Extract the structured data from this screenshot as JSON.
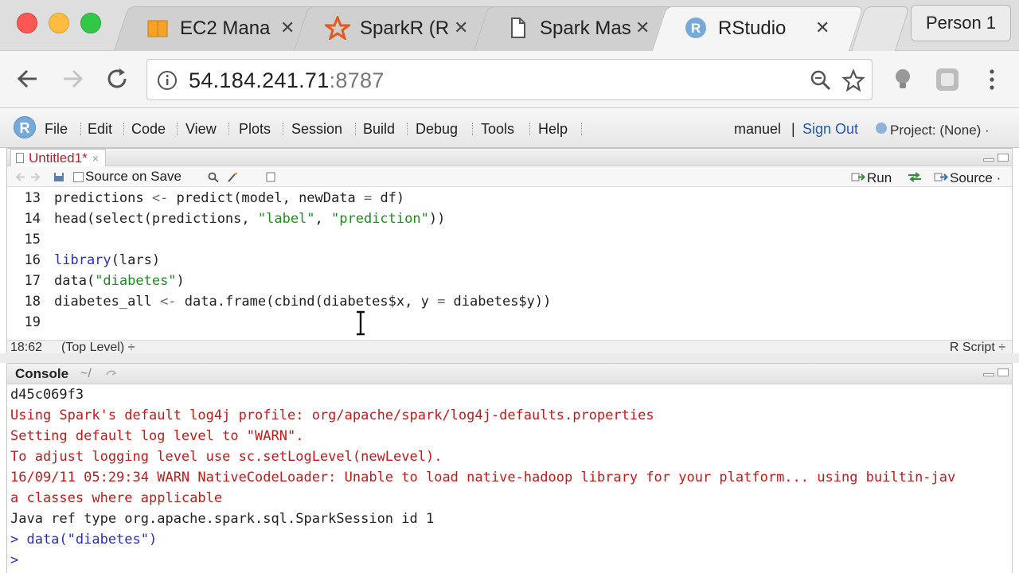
{
  "browser": {
    "tabs": [
      {
        "title": "EC2 Mana",
        "icon": "aws-cube-icon",
        "active": false
      },
      {
        "title": "SparkR (R",
        "icon": "spark-star-icon",
        "active": false
      },
      {
        "title": "Spark Mas",
        "icon": "document-icon",
        "active": false
      },
      {
        "title": "RStudio",
        "icon": "rstudio-logo-icon",
        "active": true
      }
    ],
    "person": "Person 1",
    "url_host": "54.184.241.71",
    "url_port": ":8787"
  },
  "rstudio": {
    "logo": "R",
    "menu": [
      "File",
      "Edit",
      "Code",
      "View",
      "Plots",
      "Session",
      "Build",
      "Debug",
      "Tools",
      "Help"
    ],
    "user": "manuel",
    "user_sep": "|",
    "signout": "Sign Out",
    "project": "Project: (None) ·",
    "source": {
      "tab_title": "Untitled1*",
      "tab_close": "×",
      "source_on_save": "Source on Save",
      "run_label": "Run",
      "source_label": "Source ·",
      "lines": [
        {
          "n": "13",
          "parts": [
            {
              "t": "predictions ",
              "c": ""
            },
            {
              "t": "<-",
              "c": "op"
            },
            {
              "t": " predict(model, newData ",
              "c": ""
            },
            {
              "t": "=",
              "c": "op"
            },
            {
              "t": " df)",
              "c": ""
            }
          ]
        },
        {
          "n": "14",
          "parts": [
            {
              "t": "head(select(predictions, ",
              "c": ""
            },
            {
              "t": "\"label\"",
              "c": "str"
            },
            {
              "t": ", ",
              "c": ""
            },
            {
              "t": "\"prediction\"",
              "c": "str"
            },
            {
              "t": "))",
              "c": ""
            }
          ]
        },
        {
          "n": "15",
          "parts": []
        },
        {
          "n": "16",
          "parts": [
            {
              "t": "library",
              "c": "kw"
            },
            {
              "t": "(lars)",
              "c": ""
            }
          ]
        },
        {
          "n": "17",
          "parts": [
            {
              "t": "data(",
              "c": ""
            },
            {
              "t": "\"diabetes\"",
              "c": "str"
            },
            {
              "t": ")",
              "c": ""
            }
          ]
        },
        {
          "n": "18",
          "parts": [
            {
              "t": "diabetes_all ",
              "c": ""
            },
            {
              "t": "<-",
              "c": "op"
            },
            {
              "t": " data.frame(cbind(diabetes$x, y ",
              "c": ""
            },
            {
              "t": "=",
              "c": "op"
            },
            {
              "t": " diabetes$y))",
              "c": ""
            }
          ]
        },
        {
          "n": "19",
          "parts": []
        }
      ],
      "status_pos": "18:62",
      "status_level": "(Top Level) ÷",
      "status_type": "R Script ÷"
    },
    "console": {
      "title": "Console",
      "path": "~/",
      "lines": [
        {
          "text": "d45c069f3",
          "kind": "out"
        },
        {
          "text": "Using Spark's default log4j profile: org/apache/spark/log4j-defaults.properties",
          "kind": "err"
        },
        {
          "text": "Setting default log level to \"WARN\".",
          "kind": "err"
        },
        {
          "text": "To adjust logging level use sc.setLogLevel(newLevel).",
          "kind": "err"
        },
        {
          "text": "16/09/11 05:29:34 WARN NativeCodeLoader: Unable to load native-hadoop library for your platform... using builtin-jav",
          "kind": "err"
        },
        {
          "text": "a classes where applicable",
          "kind": "err"
        },
        {
          "text": "Java ref type org.apache.spark.sql.SparkSession id 1",
          "kind": "out"
        },
        {
          "text": "> data(\"diabetes\")",
          "kind": "cmd"
        },
        {
          "text": "> ",
          "kind": "cmd"
        }
      ]
    }
  }
}
